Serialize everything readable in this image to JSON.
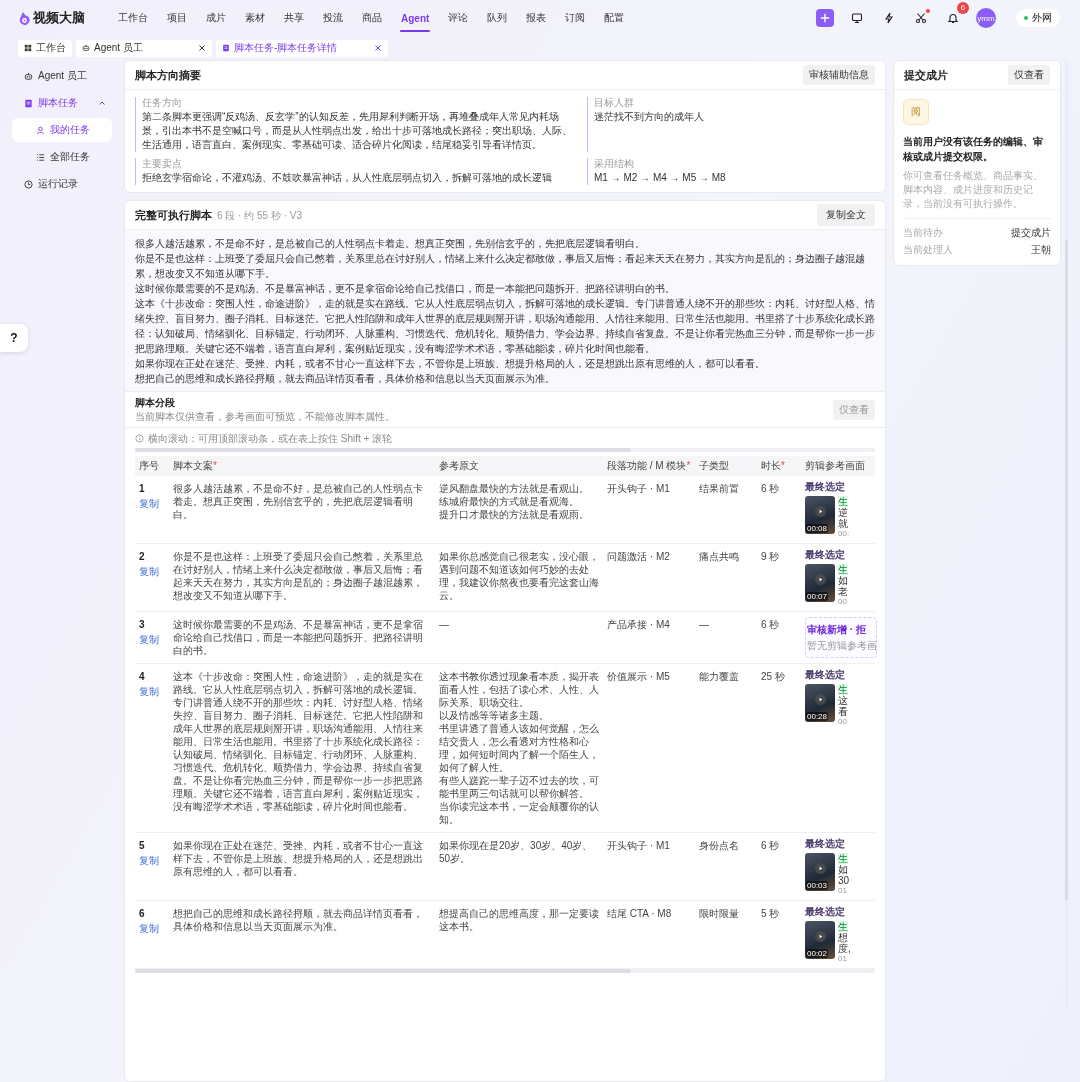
{
  "app": {
    "logo": "视频大脑"
  },
  "nav": [
    {
      "label": "工作台",
      "selected": false
    },
    {
      "label": "项目",
      "selected": false
    },
    {
      "label": "成片",
      "selected": false
    },
    {
      "label": "素材",
      "selected": false
    },
    {
      "label": "共享",
      "selected": false
    },
    {
      "label": "投流",
      "selected": false
    },
    {
      "label": "商品",
      "selected": false
    },
    {
      "label": "Agent",
      "selected": true
    },
    {
      "label": "评论",
      "selected": false
    },
    {
      "label": "队列",
      "selected": false
    },
    {
      "label": "报表",
      "selected": false
    },
    {
      "label": "订阅",
      "selected": false
    },
    {
      "label": "配置",
      "selected": false
    }
  ],
  "toolbar": [
    {
      "kind": "add",
      "alert": false
    },
    {
      "kind": "screen",
      "alert": false
    },
    {
      "kind": "bolt",
      "alert": false
    },
    {
      "kind": "scissors",
      "alert": true
    },
    {
      "kind": "bell",
      "alert": false,
      "badge": "6"
    }
  ],
  "user": {
    "avatar": "ymm"
  },
  "help": {
    "label": "?"
  },
  "network": {
    "label": "外网"
  },
  "tabs": [
    {
      "label": "工作台",
      "kind": "grid",
      "closable": false,
      "selected": false
    },
    {
      "label": "Agent 员工",
      "kind": "robot",
      "closable": true,
      "selected": false
    },
    {
      "label": "脚本任务-脚本任务详情",
      "kind": "doc",
      "closable": true,
      "selected": true
    }
  ],
  "sidebar": {
    "items": [
      {
        "label": "Agent 员工",
        "kind": "robot",
        "selected": false
      },
      {
        "label": "脚本任务",
        "kind": "doc",
        "selected": false,
        "expanded": true,
        "children": [
          {
            "label": "我的任务",
            "kind": "user",
            "selected": true
          },
          {
            "label": "全部任务",
            "kind": "list",
            "selected": false
          }
        ]
      },
      {
        "label": "运行记录",
        "kind": "clock",
        "selected": false
      }
    ]
  },
  "summary": {
    "title": "脚本方向摘要",
    "button": "审核辅助信息",
    "fields": [
      {
        "label": "任务方向",
        "value": "第二条脚本更强调“反鸡汤、反玄学”的认知反差，先用犀利判断开场，再堆叠成年人常见内耗场景，引出本书不是空喊口号，而是从人性弱点出发，给出十步可落地成长路径；突出职场、人际、生活通用，语言直白、案例现实、零基础可读、适合碎片化阅读，结尾稳妥引导看详情页。"
      },
      {
        "label": "目标人群",
        "value": "迷茫找不到方向的成年人"
      },
      {
        "label": "主要卖点",
        "value": "拒绝玄学宿命论，不灌鸡汤、不鼓吹暴富神话，从人性底层弱点切入，拆解可落地的成长逻辑"
      },
      {
        "label": "采用结构",
        "value": "M1 → M2 → M4 → M5 → M8"
      }
    ]
  },
  "script": {
    "title": "完整可执行脚本",
    "meta": "6 段 · 约 55 秒 · V3",
    "button": "复制全文",
    "paragraphs": [
      "很多人越活越累，不是命不好，是总被自己的人性弱点卡着走。想真正突围，先别信玄乎的，先把底层逻辑看明白。",
      "你是不是也这样：上班受了委屈只会自己憋着，关系里总在讨好别人，情绪上来什么决定都敢做，事后又后悔；看起来天天在努力，其实方向是乱的；身边圈子越混越累，想改变又不知道从哪下手。",
      "这时候你最需要的不是鸡汤、不是暴富神话，更不是拿宿命论给自己找借口，而是一本能把问题拆开、把路径讲明白的书。",
      "这本《十步改命：突围人性，命途进阶》，走的就是实在路线。它从人性底层弱点切入，拆解可落地的成长逻辑。专门讲普通人绕不开的那些坎：内耗、讨好型人格、情绪失控、盲目努力、圈子消耗、目标迷茫。它把人性陷阱和成年人世界的底层规则掰开讲，职场沟通能用、人情往来能用、日常生活也能用。书里搭了十步系统化成长路径：认知破局、情绪驯化、目标锚定、行动闭环、人脉重构、习惯迭代、危机转化、顺势借力、学会边界、持续自省复盘。不是让你看完热血三分钟，而是帮你一步一步把思路理顺。关键它还不端着，语言直白犀利，案例贴近现实，没有晦涩学术术语，零基础能读，碎片化时间也能看。",
      "如果你现在正处在迷茫、受挫、内耗，或者不甘心一直这样下去，不管你是上班族、想提升格局的人，还是想跳出原有思维的人，都可以看看。",
      "想把自己的思维和成长路径捋顺，就去商品详情页看看，具体价格和信息以当天页面展示为准。"
    ]
  },
  "segments": {
    "title": "脚本分段",
    "subtitle": "当前脚本仅供查看，参考画面可预览，不能修改脚本属性。",
    "button": "仅查看",
    "hint": "横向滚动：可用顶部滚动条，或在表上按住 Shift + 滚轮",
    "columns": [
      {
        "label": "序号"
      },
      {
        "label": "脚本文案",
        "required_mark": "*"
      },
      {
        "label": "参考原文"
      },
      {
        "label": "段落功能 / M 模块",
        "required_mark": "*"
      },
      {
        "label": "子类型"
      },
      {
        "label": "时长",
        "required_mark": "*"
      },
      {
        "label": "剪辑参考画面"
      }
    ],
    "rows": [
      {
        "index": "1",
        "copy": "复制",
        "script": "很多人越活越累，不是命不好，是总被自己的人性弱点卡着走。想真正突围，先别信玄乎的，先把底层逻辑看明白。",
        "reference": [
          "逆风翻盘最快的方法就是看观山。",
          "练城府最快的方式就是看观海。",
          "提升口才最快的方法就是看观雨。"
        ],
        "function": "开头钩子 · M1",
        "subtype": "结果前置",
        "duration": "6 秒",
        "clip": {
          "kind": "video",
          "status": "最终选定",
          "length": "00:08",
          "tag": "生",
          "title_lines": [
            "逆",
            "就"
          ],
          "time": "00:"
        }
      },
      {
        "index": "2",
        "copy": "复制",
        "script": "你是不是也这样：上班受了委屈只会自己憋着，关系里总在讨好别人，情绪上来什么决定都敢做，事后又后悔；看起来天天在努力，其实方向是乱的；身边圈子越混越累，想改变又不知道从哪下手。",
        "reference": [
          "如果你总感觉自己很老实，没心眼，遇到问题不知道该如何巧妙的去处理，我建议你熬夜也要看完这套山海云。"
        ],
        "function": "问题激活 · M2",
        "subtype": "痛点共鸣",
        "duration": "9 秒",
        "clip": {
          "kind": "video",
          "status": "最终选定",
          "length": "00:07",
          "tag": "生",
          "title_lines": [
            "如",
            "老"
          ],
          "time": "00"
        }
      },
      {
        "index": "3",
        "copy": "复制",
        "script": "这时候你最需要的不是鸡汤、不是暴富神话，更不是拿宿命论给自己找借口，而是一本能把问题拆开、把路径讲明白的书。",
        "reference": [
          "—"
        ],
        "function": "产品承接 · M4",
        "subtype": "—",
        "duration": "6 秒",
        "clip": {
          "kind": "empty",
          "status": "审核新增 · 拒",
          "note": "暂无剪辑参考画"
        }
      },
      {
        "index": "4",
        "copy": "复制",
        "script": "这本《十步改命：突围人性，命途进阶》，走的就是实在路线。它从人性底层弱点切入，拆解可落地的成长逻辑。专门讲普通人绕不开的那些坎：内耗、讨好型人格、情绪失控、盲目努力、圈子消耗、目标迷茫。它把人性陷阱和成年人世界的底层规则掰开讲，职场沟通能用、人情往来能用、日常生活也能用。书里搭了十步系统化成长路径：认知破局、情绪驯化、目标锚定、行动闭环、人脉重构、习惯迭代、危机转化、顺势借力、学会边界、持续自省复盘。不是让你看完热血三分钟，而是帮你一步一步把思路理顺。关键它还不端着，语言直白犀利，案例贴近现实，没有晦涩学术术语，零基础能读，碎片化时间也能看。",
        "reference": [
          "这本书教你透过现象看本质，揭开表面看人性，包括了读心术、人性、人际关系、职场交往。",
          "以及情感等等诸多主题。",
          "书里讲透了普通人该如何觉醒，怎么结交贵人，怎么看透对方性格和心理，如何短时间内了解一个陌生人，如何了解人性。",
          "有些人蹉跎一辈子迈不过去的坎，可能书里两三句话就可以帮你解答。",
          "当你读完这本书，一定会颠覆你的认知。"
        ],
        "function": "价值展示 · M5",
        "subtype": "能力覆盖",
        "duration": "25 秒",
        "clip": {
          "kind": "video",
          "status": "最终选定",
          "length": "00:28",
          "tag": "生",
          "title_lines": [
            "这",
            "看"
          ],
          "time": "00"
        }
      },
      {
        "index": "5",
        "copy": "复制",
        "script": "如果你现在正处在迷茫、受挫、内耗，或者不甘心一直这样下去，不管你是上班族、想提升格局的人，还是想跳出原有思维的人，都可以看看。",
        "reference": [
          "如果你现在是20岁、30岁、40岁、50岁。"
        ],
        "function": "开头钩子 · M1",
        "subtype": "身份点名",
        "duration": "6 秒",
        "clip": {
          "kind": "video",
          "status": "最终选定",
          "length": "00:03",
          "tag": "生",
          "title_lines": [
            "如",
            "30"
          ],
          "time": "01"
        }
      },
      {
        "index": "6",
        "copy": "复制",
        "script": "想把自己的思维和成长路径捋顺，就去商品详情页看看，具体价格和信息以当天页面展示为准。",
        "reference": [
          "想提高自己的思维高度，那一定要读这本书。"
        ],
        "function": "结尾 CTA · M8",
        "subtype": "限时限量",
        "duration": "5 秒",
        "clip": {
          "kind": "video",
          "status": "最终选定",
          "length": "00:02",
          "tag": "生",
          "title_lines": [
            "想",
            "度,"
          ],
          "time": "01"
        }
      }
    ]
  },
  "submit": {
    "title": "提交成片",
    "button": "仅查看",
    "badge": "阅",
    "message": "当前用户没有该任务的编辑、审核或成片提交权限。",
    "description": "你可查看任务概览、商品事实、脚本内容、成片进度和历史记录，当前没有可执行操作。",
    "details": [
      {
        "label": "当前待办",
        "value": "提交成片"
      },
      {
        "label": "当前处理人",
        "value": "王朝"
      }
    ]
  }
}
